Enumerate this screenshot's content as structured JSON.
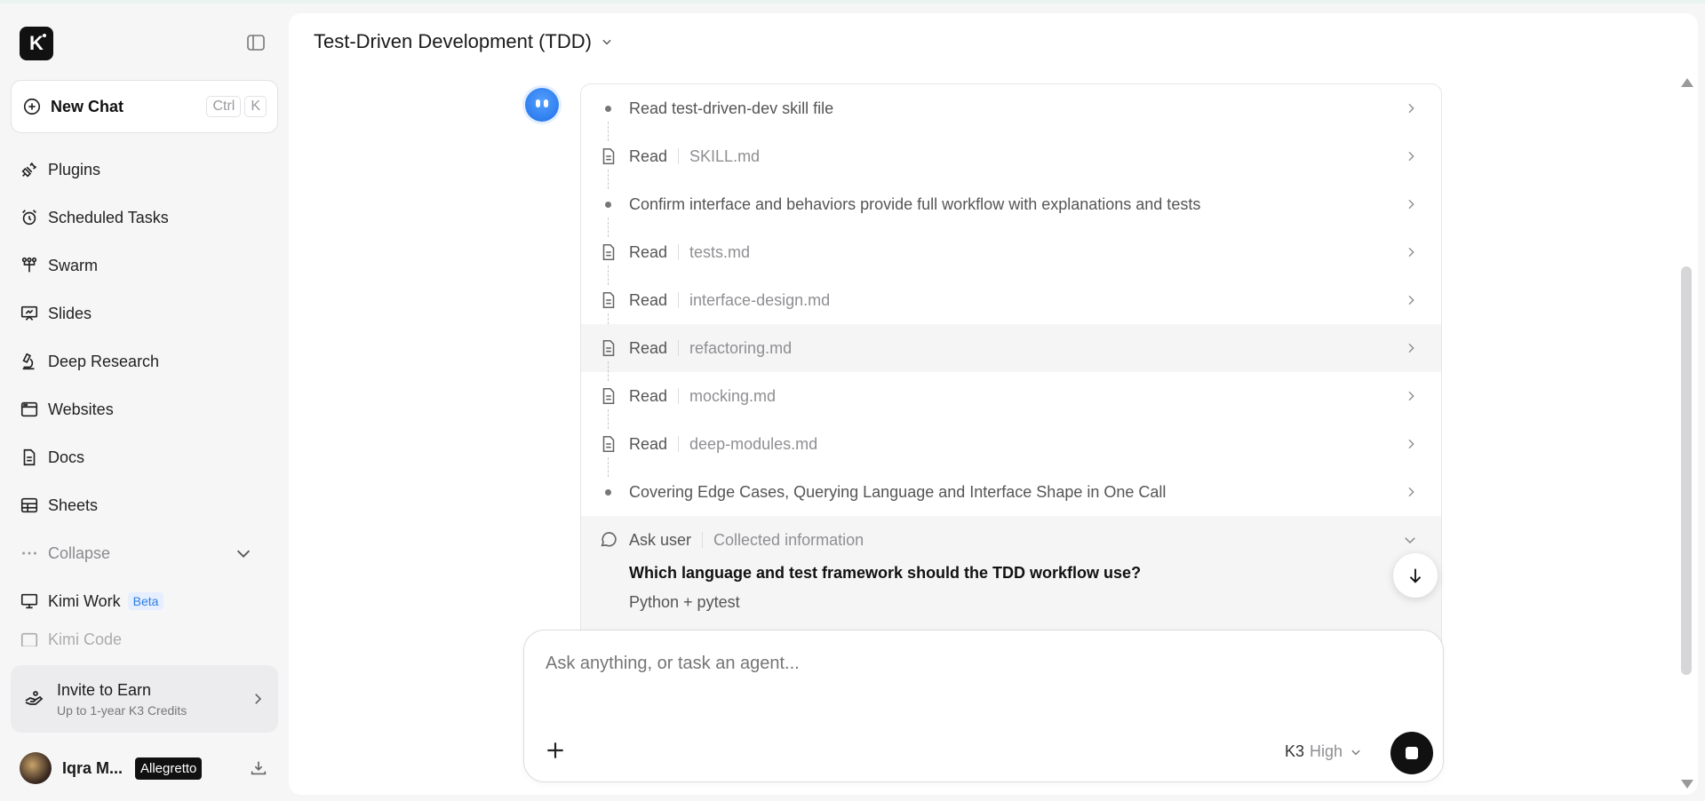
{
  "app": {
    "logo_letter": "K"
  },
  "sidebar": {
    "new_chat_label": "New Chat",
    "shortcut_ctrl": "Ctrl",
    "shortcut_key": "K",
    "items": [
      {
        "label": "Plugins",
        "icon": "plug-icon"
      },
      {
        "label": "Scheduled Tasks",
        "icon": "alarm-clock-icon"
      },
      {
        "label": "Swarm",
        "icon": "swarm-icon"
      },
      {
        "label": "Slides",
        "icon": "presentation-icon"
      },
      {
        "label": "Deep Research",
        "icon": "microscope-icon"
      },
      {
        "label": "Websites",
        "icon": "browser-window-icon"
      },
      {
        "label": "Docs",
        "icon": "document-icon"
      },
      {
        "label": "Sheets",
        "icon": "table-icon"
      }
    ],
    "collapse_label": "Collapse",
    "kimi_work_label": "Kimi Work",
    "beta_label": "Beta",
    "kimi_code_label": "Kimi Code",
    "invite_title": "Invite to Earn",
    "invite_subtitle": "Up to 1-year K3 Credits",
    "user_name": "Iqra M...",
    "user_plan": "Allegretto"
  },
  "main": {
    "title": "Test-Driven Development (TDD)",
    "steps": [
      {
        "type": "bullet",
        "text": "Read test-driven-dev skill file"
      },
      {
        "type": "read",
        "verb": "Read",
        "file": "SKILL.md"
      },
      {
        "type": "bullet",
        "text": "Confirm interface and behaviors provide full workflow with explanations and tests"
      },
      {
        "type": "read",
        "verb": "Read",
        "file": "tests.md"
      },
      {
        "type": "read",
        "verb": "Read",
        "file": "interface-design.md"
      },
      {
        "type": "read",
        "verb": "Read",
        "file": "refactoring.md",
        "highlighted": true
      },
      {
        "type": "read",
        "verb": "Read",
        "file": "mocking.md"
      },
      {
        "type": "read",
        "verb": "Read",
        "file": "deep-modules.md"
      },
      {
        "type": "bullet",
        "text": "Covering Edge Cases, Querying Language and Interface Shape in One Call"
      }
    ],
    "ask": {
      "verb": "Ask user",
      "detail": "Collected information",
      "question": "Which language and test framework should the TDD workflow use?",
      "answer": "Python + pytest"
    },
    "composer": {
      "placeholder": "Ask anything, or task an agent...",
      "model": "K3",
      "effort": "High"
    }
  }
}
